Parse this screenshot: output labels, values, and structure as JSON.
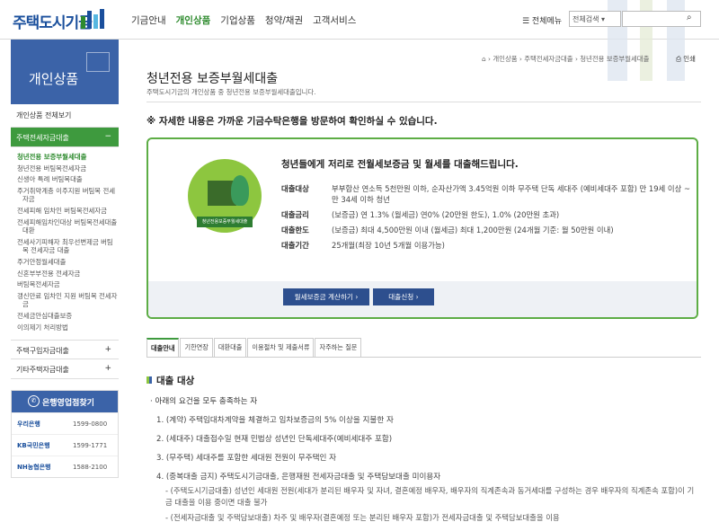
{
  "header": {
    "logo_text": "주택도시기금",
    "nav": [
      "기금안내",
      "개인상품",
      "기업상품",
      "청약/채권",
      "고객서비스"
    ],
    "nav_active_index": 1,
    "all_menu": "☰ 전체메뉴",
    "search_select": "전체검색",
    "search_placeholder": "",
    "search_icon": "search-icon"
  },
  "sidebar": {
    "title": "개인상품",
    "all_view": "개인상품 전체보기",
    "cat_jeonse": "주택전세자금대출",
    "cat_jeonse_sign": "−",
    "sub_items": [
      "청년전용 보증부월세대출",
      "청년전용 버팀목전세자금",
      "신생아 특례 버팀목대출",
      "주거취약계층 이주지원 버팀목 전세자금",
      "전세피해 임차인 버팀목전세자금",
      "전세피해임차인대상 버팀목전세대출대환",
      "전세사기피해자 최우선변제금 버팀목 전세자금 대출",
      "주거안정월세대출",
      "신혼부부전용 전세자금",
      "버팀목전세자금",
      "갱신만료 임차인 지원 버팀목 전세자금",
      "전세금안심대출보증",
      "이의제기 처리방법"
    ],
    "cat_purchase": "주택구입자금대출",
    "cat_purchase_sign": "+",
    "cat_other": "기타주택자금대출",
    "cat_other_sign": "+",
    "branch_title": "은행영업점찾기",
    "banks": [
      {
        "name": "우리은행",
        "num": "1599-0800"
      },
      {
        "name": "KB국민은행",
        "num": "1599-1771"
      },
      {
        "name": "NH농협은행",
        "num": "1588-2100"
      }
    ]
  },
  "content": {
    "breadcrumb": "⌂  ›  개인상품  ›  주택전세자금대출  ›  청년전용 보증부월세대출",
    "print": "인쇄",
    "title": "청년전용 보증부월세대출",
    "subtitle": "주택도시기금의 개인상품 중 청년전용 보증부월세대출입니다.",
    "notice": "※ 자세한 내용은 가까운 기금수탁은행을 방문하여 확인하실 수 있습니다.",
    "box_logo_label": "청년전용보증부월세대출",
    "box_head": "청년들에게 저리로 전월세보증금 및 월세를 대출해드립니다.",
    "info": [
      {
        "k": "대출대상",
        "v": "부부합산 연소득 5천만원 이하, 순자산가액 3.45억원 이하 무주택 단독 세대주 (예비세대주 포함) 만 19세 이상 ~ 만 34세 이하 청년"
      },
      {
        "k": "대출금리",
        "v": "(보증금) 연 1.3% (월세금) 연0% (20만원 한도), 1.0% (20만원 초과)"
      },
      {
        "k": "대출한도",
        "v": "(보증금) 최대 4,500만원 이내 (월세금) 최대 1,200만원 (24개월 기준: 월 50만원 이내)"
      },
      {
        "k": "대출기간",
        "v": "25개월(최장 10년 5개월 이용가능)"
      }
    ],
    "btn_calc": "월세보증금 계산하기  ›",
    "btn_apply": "대출신청  ›",
    "tabs": [
      "대출안내",
      "기한연장",
      "대환대출",
      "이용절차 및 제출서류",
      "자주하는 질문"
    ],
    "section_title": "대출 대상",
    "lead": "· 아래의 요건을 모두 충족하는 자",
    "items": [
      "1. (계약) 주택임대차계약을 체결하고 임차보증금의 5% 이상을 지불한 자",
      "2. (세대주) 대출접수일 현재 민법상 성년인 단독세대주(예비세대주 포함)",
      "3. (무주택) 세대주를 포함한 세대원 전원이 무주택인 자",
      "4. (중복대출 금지) 주택도시기금대출, 은행재원 전세자금대출 및 주택담보대출 미이용자"
    ],
    "sub_items": [
      "- (주택도시기금대출) 성년인 세대원 전원(세대가 분리된 배우자 및 자녀, 결혼예정 배우자, 배우자의 직계존속과 동거세대를 구성하는 경우 배우자의 직계존속 포함)이 기금 대출을 이용 중이면 대출 불가",
      "- (전세자금대출 및 주택담보대출) 차주 및 배우자(결혼예정 또는 분리된 배우자 포함)가 전세자금대출 및 주택담보대출을 이용"
    ]
  }
}
